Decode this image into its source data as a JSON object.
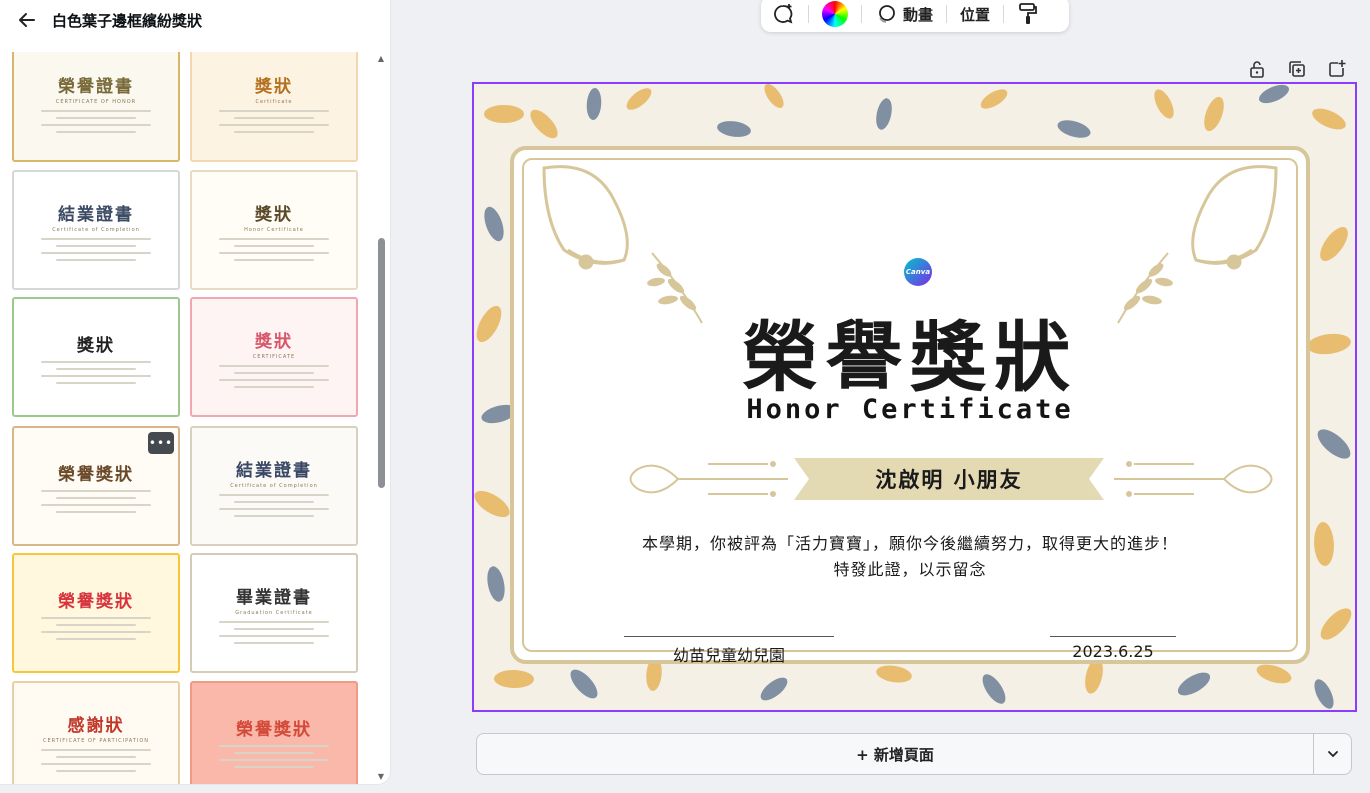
{
  "panel": {
    "title": "白色葉子邊框繽紛獎狀",
    "templates": [
      {
        "title": "榮譽證書",
        "sub": "CERTIFICATE OF HONOR",
        "bg": "#fbf8f0",
        "color": "#7a6a3a",
        "border": "#d8b66a"
      },
      {
        "title": "獎狀",
        "sub": "Certificate",
        "bg": "#fdf3e2",
        "color": "#b5711f",
        "border": "#f2d7b0"
      },
      {
        "title": "結業證書",
        "sub": "Certificate of Completion",
        "bg": "#ffffff",
        "color": "#3c4b63",
        "border": "#d7d7d7"
      },
      {
        "title": "獎狀",
        "sub": "Honor Certificate",
        "bg": "#fffdf6",
        "color": "#5b4a2a",
        "border": "#e7dcc3"
      },
      {
        "title": "獎狀",
        "sub": "",
        "bg": "#ffffff",
        "color": "#222222",
        "border": "#9cc98c"
      },
      {
        "title": "獎狀",
        "sub": "CERTIFICATE",
        "bg": "#fff4f4",
        "color": "#d8576b",
        "border": "#f2a6b2"
      },
      {
        "title": "榮譽獎狀",
        "sub": "",
        "bg": "#fffbf5",
        "color": "#6b4a2a",
        "border": "#d8b68a"
      },
      {
        "title": "結業證書",
        "sub": "Certificate of Completion",
        "bg": "#fbfaf6",
        "color": "#3a4866",
        "border": "#d8d1bd"
      },
      {
        "title": "榮譽獎狀",
        "sub": "",
        "bg": "#fff8de",
        "color": "#d8343e",
        "border": "#f7c73b"
      },
      {
        "title": "畢業證書",
        "sub": "Graduation Certificate",
        "bg": "#ffffff",
        "color": "#333333",
        "border": "#d4cbb8"
      },
      {
        "title": "感謝狀",
        "sub": "CERTIFICATE OF PARTICIPATION",
        "bg": "#fffaf2",
        "color": "#c0392b",
        "border": "#e9cfa8"
      },
      {
        "title": "榮譽獎狀",
        "sub": "",
        "bg": "#f9b8a9",
        "color": "#d44a3a",
        "border": "#f29a86"
      }
    ],
    "more_label": "•••"
  },
  "toolbar": {
    "animate_label": "動畫",
    "position_label": "位置"
  },
  "certificate": {
    "title": "榮譽獎狀",
    "subtitle": "Honor Certificate",
    "recipient": "沈啟明  小朋友",
    "body_line1": "本學期，你被評為「活力寶寶」，願你今後繼續努力，取得更大的進步！",
    "body_line2": "特發此證，以示留念",
    "issuer": "幼苗兒童幼兒園",
    "date": "2023.6.25",
    "logo_text": "Canva",
    "colors": {
      "gold": "#d6c69a",
      "ribbon": "#e3d9b3",
      "leaf_gold": "#e6b45a",
      "leaf_blue": "#6b7f95"
    }
  },
  "add_page": {
    "label": "+ 新增頁面"
  }
}
